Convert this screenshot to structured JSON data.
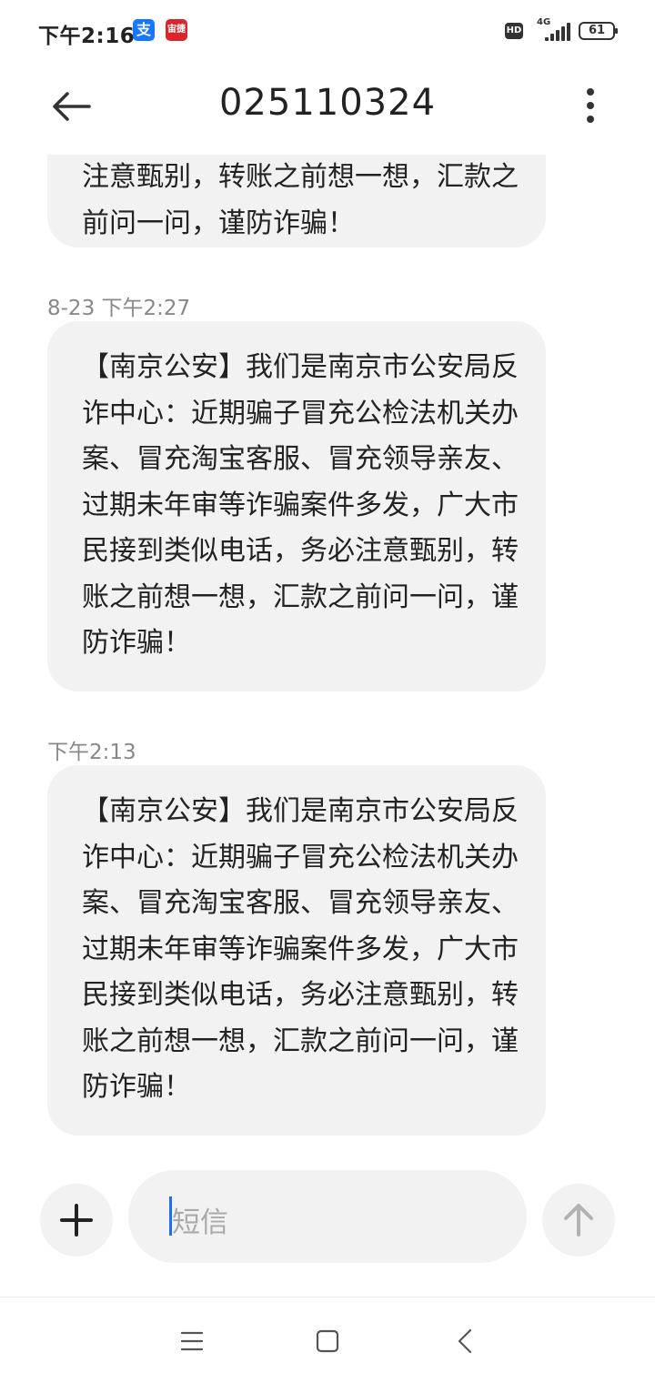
{
  "status_bar": {
    "time": "下午2:16",
    "apps": [
      {
        "icon": "alipay-icon",
        "glyph": "支"
      },
      {
        "icon": "railway-icon",
        "glyph": "宙捷"
      }
    ],
    "hd_label": "HD",
    "network_type": "4G",
    "battery": "61"
  },
  "header": {
    "title": "025110324",
    "back_icon": "arrow-left-icon",
    "more_icon": "more-vertical-icon"
  },
  "messages": [
    {
      "timestamp": "",
      "text": "注意甄别，转账之前想一想，汇款之前问一问，谨防诈骗！"
    },
    {
      "timestamp": "8-23 下午2:27",
      "text": "【南京公安】我们是南京市公安局反诈中心：近期骗子冒充公检法机关办案、冒充淘宝客服、冒充领导亲友、过期未年审等诈骗案件多发，广大市民接到类似电话，务必注意甄别，转账之前想一想，汇款之前问一问，谨防诈骗！"
    },
    {
      "timestamp": "下午2:13",
      "text": "【南京公安】我们是南京市公安局反诈中心：近期骗子冒充公检法机关办案、冒充淘宝客服、冒充领导亲友、过期未年审等诈骗案件多发，广大市民接到类似电话，务必注意甄别，转账之前想一想，汇款之前问一问，谨防诈骗！"
    }
  ],
  "composer": {
    "placeholder": "短信",
    "add_icon": "plus-icon",
    "send_icon": "arrow-up-icon"
  },
  "nav_bar": {
    "menu_icon": "menu-icon",
    "home_icon": "home-square-icon",
    "back_icon": "chevron-left-icon"
  },
  "colors": {
    "bubble": "#f2f2f2",
    "caret": "#1a73e8",
    "alipay": "#1677ff",
    "railway": "#d9262c"
  }
}
